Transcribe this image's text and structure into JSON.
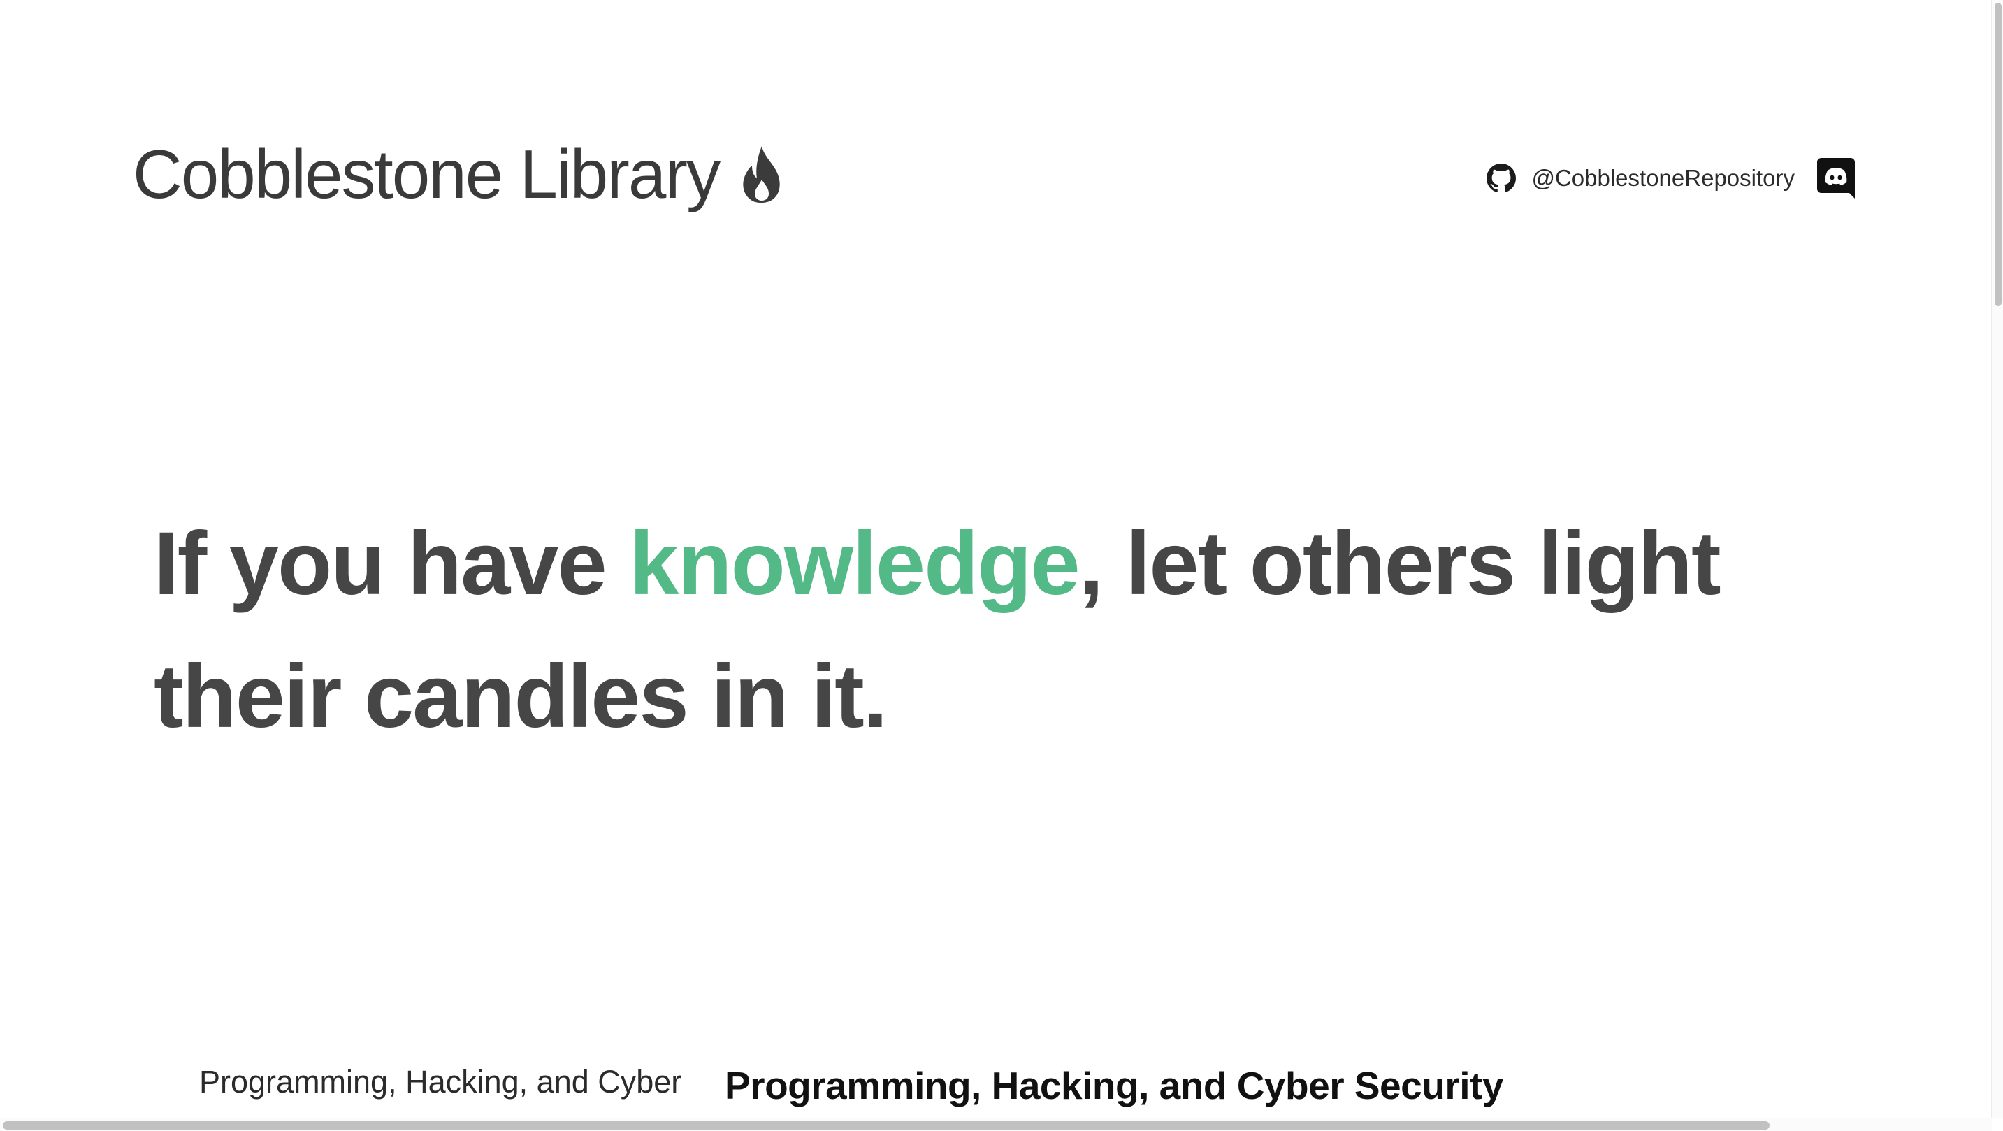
{
  "header": {
    "site_title": "Cobblestone Library",
    "logo_icon": "flame-icon",
    "github_icon": "github-icon",
    "github_handle": "@CobblestoneRepository",
    "discord_icon": "discord-icon"
  },
  "hero": {
    "quote_before": "If you have ",
    "quote_highlight": "knowledge",
    "quote_after": ", let others light their candles in it.",
    "highlight_color": "#53b987",
    "text_color": "#464646"
  },
  "topics": {
    "small_label": "Programming, Hacking, and Cyber",
    "large_label": "Programming, Hacking, and Cyber Security"
  }
}
